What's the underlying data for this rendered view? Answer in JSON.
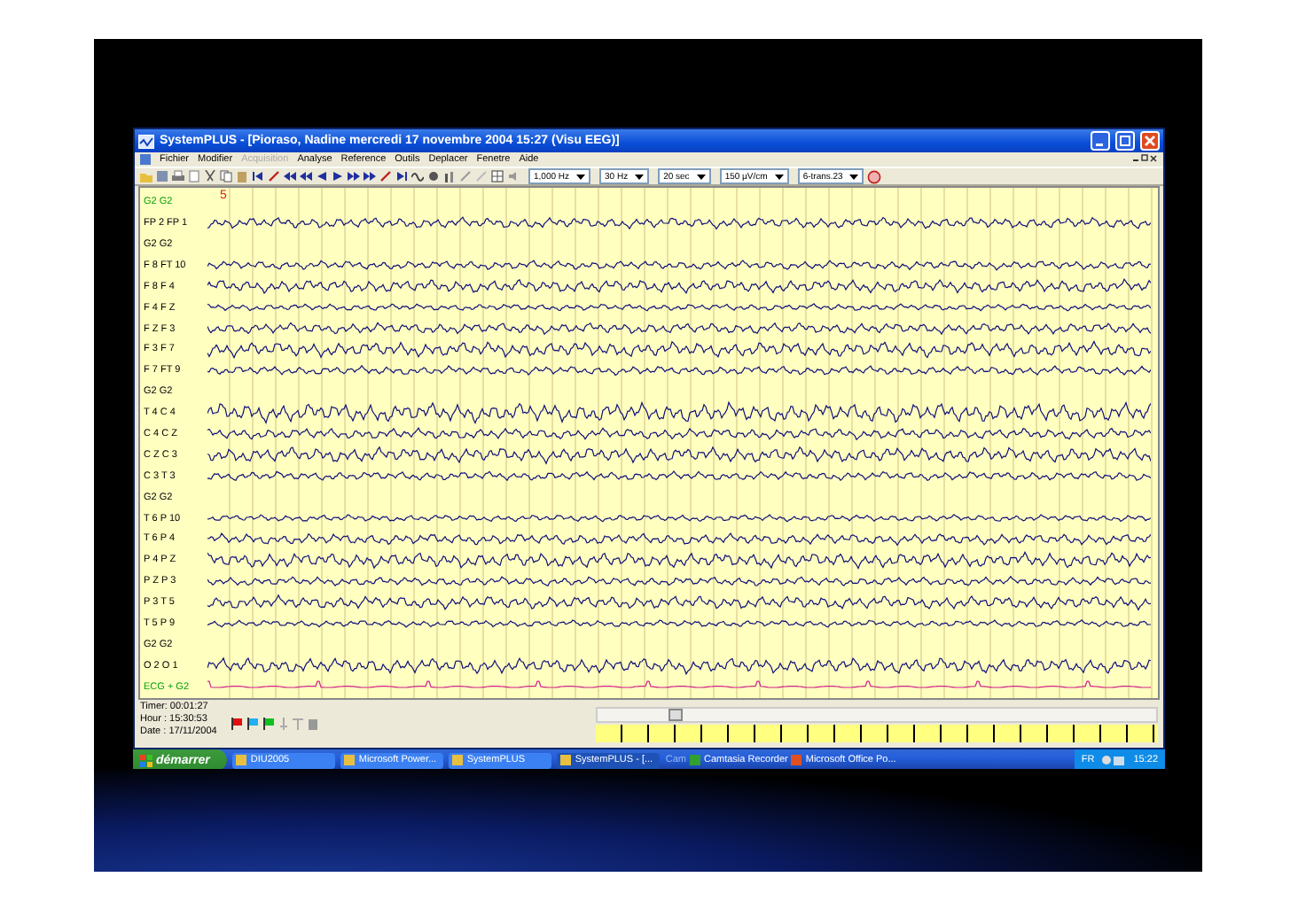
{
  "window": {
    "title": "SystemPLUS - [Pioraso, Nadine mercredi 17 novembre 2004 15:27 (Visu EEG)]",
    "menu": [
      {
        "label": "Fichier",
        "disabled": false
      },
      {
        "label": "Modifier",
        "disabled": false
      },
      {
        "label": "Acquisition",
        "disabled": true
      },
      {
        "label": "Analyse",
        "disabled": false
      },
      {
        "label": "Reference",
        "disabled": false
      },
      {
        "label": "Outils",
        "disabled": false
      },
      {
        "label": "Deplacer",
        "disabled": false
      },
      {
        "label": "Fenetre",
        "disabled": false
      },
      {
        "label": "Aide",
        "disabled": false
      }
    ],
    "dropdowns": [
      "1,000 Hz",
      "30 Hz",
      "20 sec",
      "150 µV/cm",
      "6-trans.23"
    ]
  },
  "marker": "5",
  "channels": [
    {
      "label": "G2 G2",
      "kind": "blank"
    },
    {
      "label": "FP 2 FP 1",
      "kind": "eeg"
    },
    {
      "label": "G2 G2",
      "kind": "blank"
    },
    {
      "label": "F 8 FT 10",
      "kind": "eeg"
    },
    {
      "label": "F 8 F 4",
      "kind": "eeg"
    },
    {
      "label": "F 4 F Z",
      "kind": "eeg"
    },
    {
      "label": "F Z F 3",
      "kind": "eeg"
    },
    {
      "label": "F 3 F 7",
      "kind": "eeg"
    },
    {
      "label": "F 7 FT 9",
      "kind": "eeg"
    },
    {
      "label": "G2 G2",
      "kind": "blank"
    },
    {
      "label": "T 4 C 4",
      "kind": "eeg"
    },
    {
      "label": "C 4 C Z",
      "kind": "eeg"
    },
    {
      "label": "C Z C 3",
      "kind": "eeg"
    },
    {
      "label": "C 3 T 3",
      "kind": "eeg"
    },
    {
      "label": "G2 G2",
      "kind": "blank"
    },
    {
      "label": "T 6 P 10",
      "kind": "eeg"
    },
    {
      "label": "T 6 P 4",
      "kind": "eeg"
    },
    {
      "label": "P 4 P Z",
      "kind": "eeg"
    },
    {
      "label": "P Z P 3",
      "kind": "eeg"
    },
    {
      "label": "P 3 T 5",
      "kind": "eeg"
    },
    {
      "label": "T 5 P 9",
      "kind": "eeg"
    },
    {
      "label": "G2 G2",
      "kind": "blank"
    },
    {
      "label": "O 2 O 1",
      "kind": "eeg"
    },
    {
      "label": "ECG + G2",
      "kind": "ecg"
    }
  ],
  "status": {
    "timer": "Timer: 00:01:27",
    "hour": "Hour : 15:30:53",
    "date": "Date : 17/11/2004"
  },
  "flags": [
    {
      "color": "#e01010"
    },
    {
      "color": "#20b0f0"
    },
    {
      "color": "#10c020"
    }
  ],
  "taskbar": {
    "start": "démarrer",
    "items": [
      {
        "label": "DIU2005",
        "selected": false
      },
      {
        "label": "Microsoft Power...",
        "selected": false
      },
      {
        "label": "SystemPLUS",
        "selected": false
      },
      {
        "label": "SystemPLUS - [...",
        "selected": true
      }
    ],
    "tray_items": [
      "Cam",
      "Camtasia Recorder",
      "Microsoft Office Po..."
    ],
    "language": "FR",
    "clock": "15:22"
  }
}
